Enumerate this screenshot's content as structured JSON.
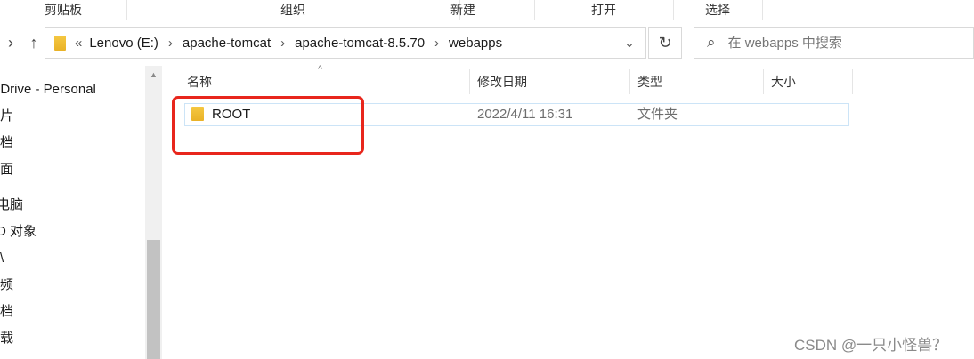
{
  "ribbon": {
    "groups": [
      "剪贴板",
      "组织",
      "新建",
      "打开",
      "选择"
    ]
  },
  "address": {
    "prefix": "«",
    "crumbs": [
      "Lenovo (E:)",
      "apache-tomcat",
      "apache-tomcat-8.5.70",
      "webapps"
    ]
  },
  "search": {
    "placeholder": "在 webapps 中搜索"
  },
  "sidebar": {
    "items": [
      "eDrive - Personal",
      "片",
      "档",
      "面",
      "电脑",
      "D 对象",
      "\\",
      "频",
      "档",
      "载"
    ]
  },
  "columns": {
    "name": "名称",
    "modified": "修改日期",
    "type": "类型",
    "size": "大小"
  },
  "files": [
    {
      "name": "ROOT",
      "modified": "2022/4/11 16:31",
      "type": "文件夹",
      "size": ""
    }
  ],
  "watermark": "CSDN @一只小怪兽？",
  "colors": {
    "highlight": "#e8261c",
    "selection_border": "#cce4f7",
    "folder": "#f5c842"
  }
}
